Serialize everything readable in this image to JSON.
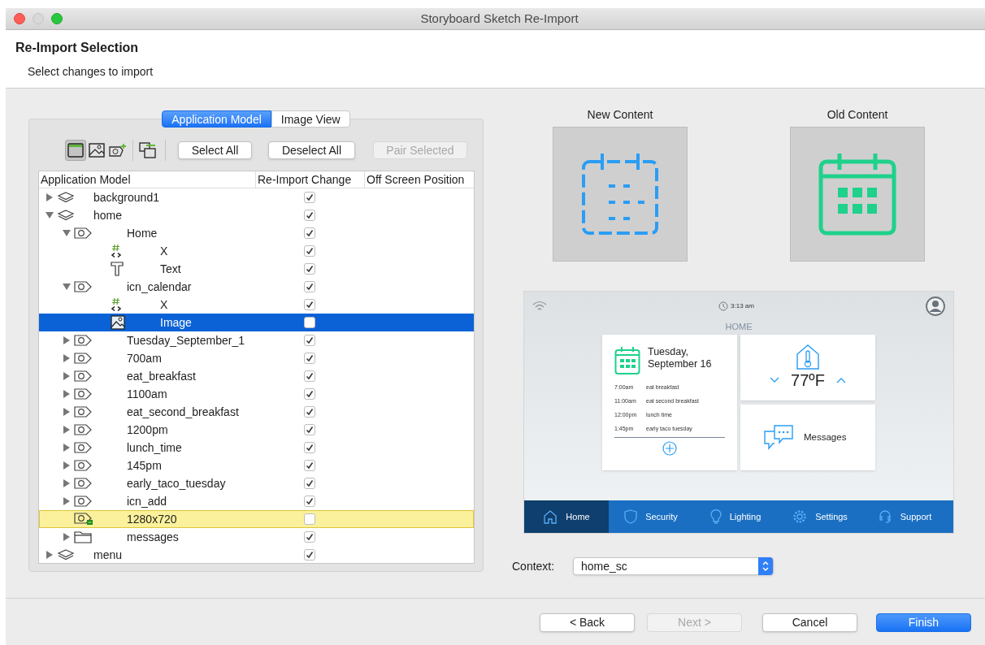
{
  "window": {
    "title": "Storyboard Sketch Re-Import"
  },
  "header": {
    "title": "Re-Import Selection",
    "subtitle": "Select changes to import"
  },
  "view_tabs": [
    {
      "label": "Application Model",
      "selected": true
    },
    {
      "label": "Image View",
      "selected": false
    }
  ],
  "toolbar": {
    "toggles": [
      {
        "kind": "screen",
        "selected": true
      },
      {
        "kind": "image",
        "selected": false
      },
      {
        "kind": "add-image",
        "selected": false
      },
      {
        "kind": "pair",
        "selected": false
      }
    ],
    "buttons": [
      {
        "label": "Select All",
        "disabled": false
      },
      {
        "label": "Deselect All",
        "disabled": false
      },
      {
        "label": "Pair Selected",
        "disabled": true
      }
    ]
  },
  "tree": {
    "columns": [
      "Application Model",
      "Re-Import Change",
      "Off Screen Position"
    ],
    "items": [
      {
        "label": "background1",
        "kind": "layer",
        "expanded": false,
        "checked": true,
        "selected": false,
        "highlighted": false
      },
      {
        "label": "home",
        "kind": "layer",
        "expanded": true,
        "checked": true,
        "selected": false,
        "highlighted": false,
        "children": [
          {
            "label": "Home",
            "kind": "control",
            "expanded": true,
            "checked": true,
            "selected": false,
            "highlighted": false,
            "children": [
              {
                "label": "X",
                "kind": "variable",
                "checked": true,
                "selected": false,
                "highlighted": false
              },
              {
                "label": "Text",
                "kind": "text",
                "checked": true,
                "selected": false,
                "highlighted": false
              }
            ]
          },
          {
            "label": "icn_calendar",
            "kind": "control",
            "expanded": true,
            "checked": true,
            "selected": false,
            "highlighted": false,
            "children": [
              {
                "label": "X",
                "kind": "variable",
                "checked": true,
                "selected": false,
                "highlighted": false
              },
              {
                "label": "Image",
                "kind": "image",
                "checked": false,
                "selected": true,
                "highlighted": false
              }
            ]
          },
          {
            "label": "Tuesday_September_1",
            "kind": "control",
            "expanded": false,
            "checked": true,
            "selected": false,
            "highlighted": false
          },
          {
            "label": "700am",
            "kind": "control",
            "expanded": false,
            "checked": true,
            "selected": false,
            "highlighted": false
          },
          {
            "label": "eat_breakfast",
            "kind": "control",
            "expanded": false,
            "checked": true,
            "selected": false,
            "highlighted": false
          },
          {
            "label": "1100am",
            "kind": "control",
            "expanded": false,
            "checked": true,
            "selected": false,
            "highlighted": false
          },
          {
            "label": "eat_second_breakfast",
            "kind": "control",
            "expanded": false,
            "checked": true,
            "selected": false,
            "highlighted": false
          },
          {
            "label": "1200pm",
            "kind": "control",
            "expanded": false,
            "checked": true,
            "selected": false,
            "highlighted": false
          },
          {
            "label": "lunch_time",
            "kind": "control",
            "expanded": false,
            "checked": true,
            "selected": false,
            "highlighted": false
          },
          {
            "label": "145pm",
            "kind": "control",
            "expanded": false,
            "checked": true,
            "selected": false,
            "highlighted": false
          },
          {
            "label": "early_taco_tuesday",
            "kind": "control",
            "expanded": false,
            "checked": true,
            "selected": false,
            "highlighted": false
          },
          {
            "label": "icn_add",
            "kind": "control",
            "expanded": false,
            "checked": true,
            "selected": false,
            "highlighted": false
          },
          {
            "label": "1280x720",
            "kind": "control-new",
            "checked": false,
            "selected": false,
            "highlighted": true
          },
          {
            "label": "messages",
            "kind": "group",
            "expanded": false,
            "checked": true,
            "selected": false,
            "highlighted": false
          }
        ]
      },
      {
        "label": "menu",
        "kind": "layer",
        "expanded": false,
        "checked": true,
        "selected": false,
        "highlighted": false
      }
    ]
  },
  "comparison": [
    {
      "label": "New Content",
      "kind": "outline-calendar"
    },
    {
      "label": "Old Content",
      "kind": "filled-calendar"
    }
  ],
  "device_screen": {
    "time": "3:13 am",
    "title": "HOME",
    "calendar": {
      "date_lines": [
        "Tuesday,",
        "September 16"
      ],
      "events": [
        {
          "time": "7:00am",
          "title": "eat breakfast"
        },
        {
          "time": "11:00am",
          "title": "eat second breakfast"
        },
        {
          "time": "12:00pm",
          "title": "lunch time"
        },
        {
          "time": "1:45pm",
          "title": "early taco tuesday"
        }
      ]
    },
    "thermostat": {
      "temperature": "77ºF"
    },
    "messages": {
      "label": "Messages"
    },
    "nav": [
      {
        "label": "Home",
        "kind": "home",
        "selected": true
      },
      {
        "label": "Security",
        "kind": "shield",
        "selected": false
      },
      {
        "label": "Lighting",
        "kind": "bulb",
        "selected": false
      },
      {
        "label": "Settings",
        "kind": "gear",
        "selected": false
      },
      {
        "label": "Support",
        "kind": "headset",
        "selected": false
      }
    ]
  },
  "context": {
    "label": "Context:",
    "value": "home_sc"
  },
  "footer_buttons": [
    {
      "label": "< Back",
      "kind": "normal",
      "disabled": false
    },
    {
      "label": "Next >",
      "kind": "normal",
      "disabled": true
    },
    {
      "label": "Cancel",
      "kind": "normal",
      "disabled": false
    },
    {
      "label": "Finish",
      "kind": "default",
      "disabled": false
    }
  ]
}
